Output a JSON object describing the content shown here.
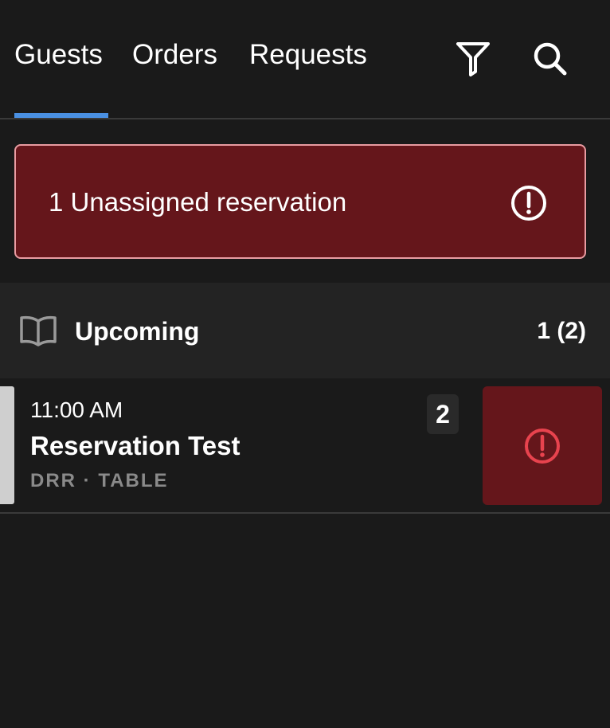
{
  "tabs": [
    {
      "label": "Guests",
      "active": true
    },
    {
      "label": "Orders",
      "active": false
    },
    {
      "label": "Requests",
      "active": false
    }
  ],
  "icons": {
    "filter": "filter-icon",
    "search": "search-icon",
    "alert": "alert-circle-icon",
    "book": "book-icon"
  },
  "alert": {
    "text": "1 Unassigned reservation"
  },
  "section": {
    "title": "Upcoming",
    "count": "1 (2)"
  },
  "reservations": [
    {
      "time": "11:00 AM",
      "name": "Reservation Test",
      "meta": "DRR · TABLE",
      "party_size": "2",
      "status_icon": "alert-circle-icon"
    }
  ],
  "colors": {
    "background": "#1a1a1a",
    "accent": "#4a90e2",
    "alert_bg": "#65161b",
    "alert_border": "#e99ca2",
    "status_icon": "#e8434e"
  }
}
